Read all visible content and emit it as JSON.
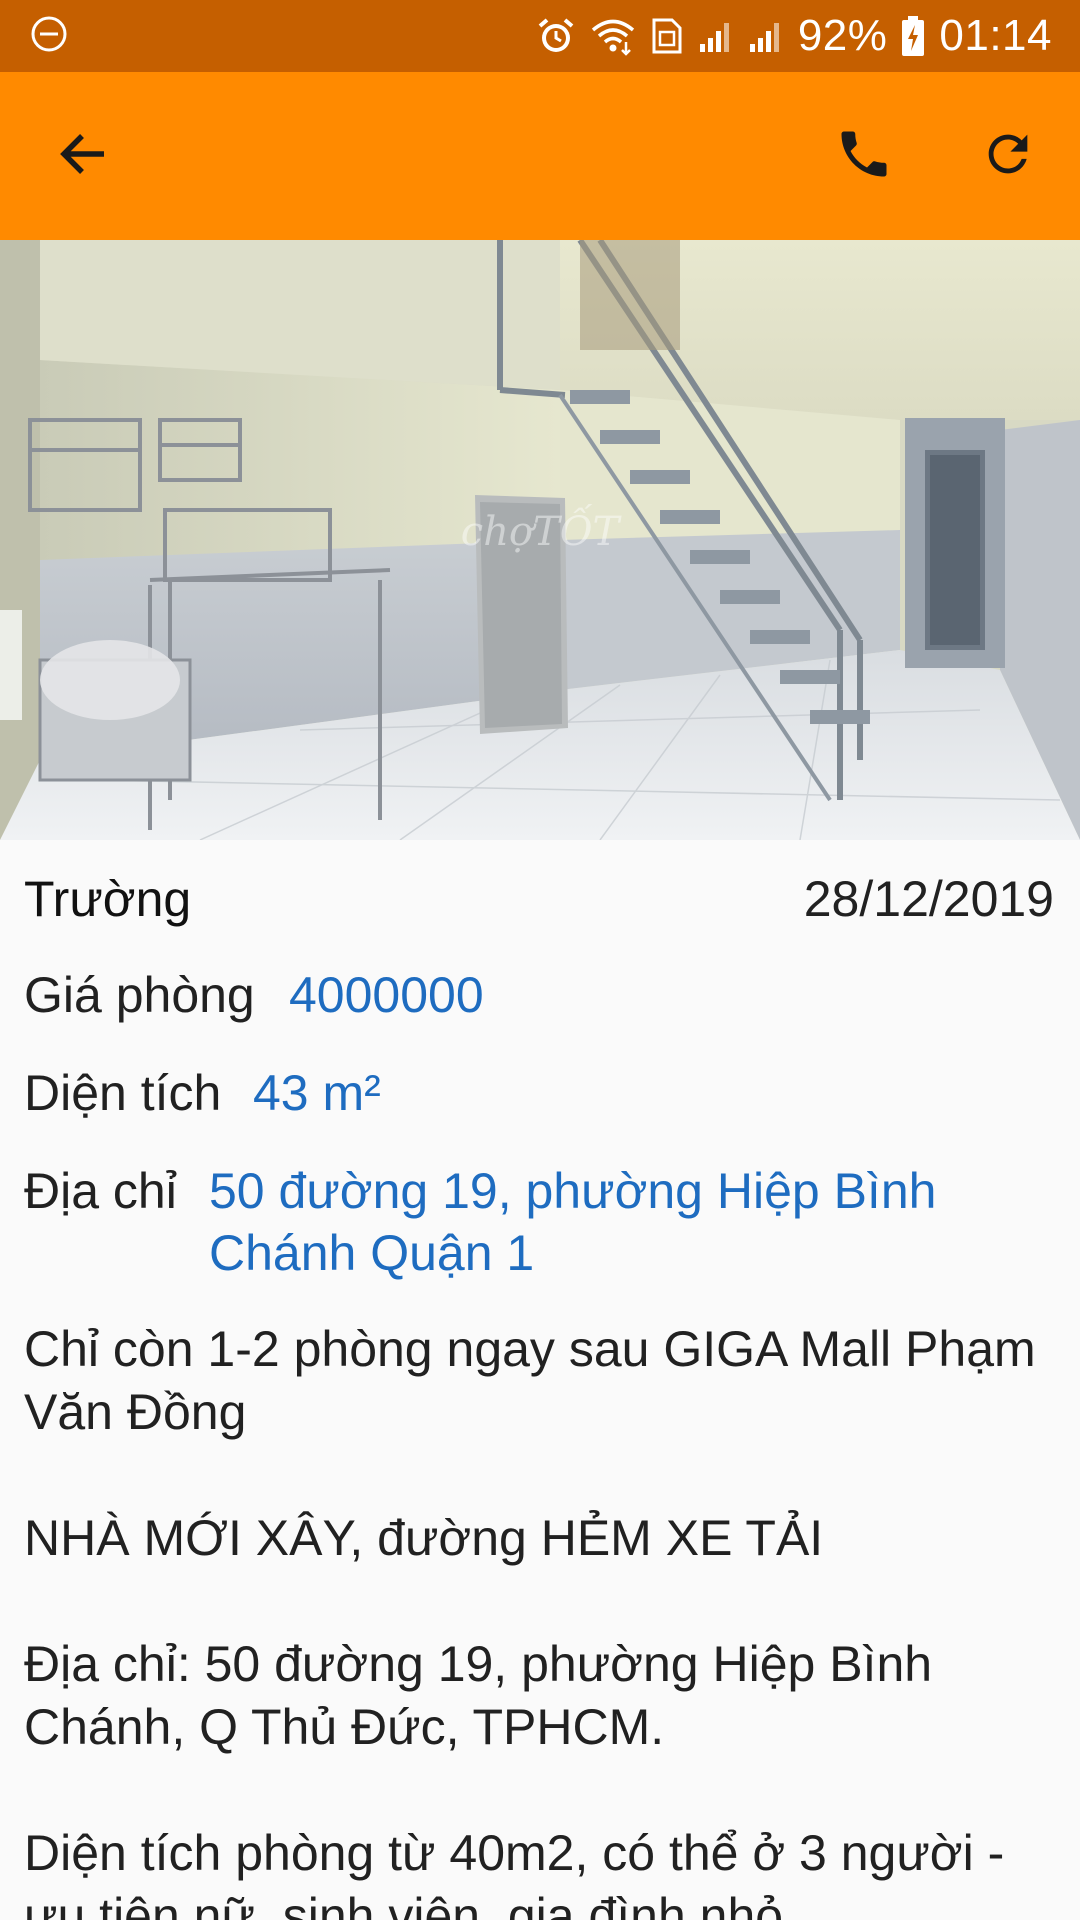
{
  "status_bar": {
    "battery": "92%",
    "time": "01:14",
    "icons": [
      "dnd-icon",
      "alarm-icon",
      "wifi-icon",
      "sim-icon",
      "signal-icon",
      "signal-icon",
      "battery-charging-icon"
    ]
  },
  "toolbar": {
    "back_icon": "arrow-back-icon",
    "call_icon": "phone-icon",
    "refresh_icon": "refresh-icon",
    "color": "#ff8a00"
  },
  "listing": {
    "owner": "Trường",
    "date": "28/12/2019",
    "price_label": "Giá phòng",
    "price_value": "4000000",
    "area_label": "Diện tích",
    "area_value": "43 m²",
    "address_label": "Địa chỉ",
    "address_value": "50 đường 19, phường Hiệp Bình Chánh Quận 1",
    "description": "Chỉ còn 1-2 phòng ngay sau GIGA Mall Phạm Văn Đồng\n\nNHÀ MỚI XÂY, đường HẺM XE TẢI\n\nĐịa chỉ: 50 đường 19, phường Hiệp Bình Chánh, Q Thủ Đức, TPHCM.\n\nDiện tích phòng từ 40m2, có thể ở 3 người - ưu tiên nữ, sinh viên, gia đình nhỏ"
  },
  "photo": {
    "watermark": "chợTỐT"
  },
  "colors": {
    "status_bar": "#c55f00",
    "accent_value": "#1e6cc0"
  }
}
